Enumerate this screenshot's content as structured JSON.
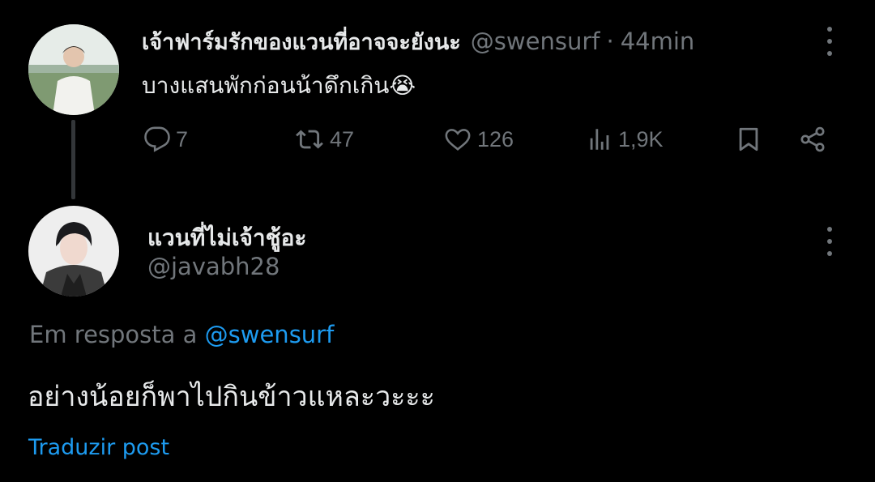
{
  "tweet1": {
    "display_name": "เจ้าฟาร์มรักของแวนที่อาจจะยังนะ",
    "handle": "@swensurf",
    "separator": "·",
    "time": "44min",
    "text": "บางแสนพักก่อนน้าดึกเกิน😭",
    "stats": {
      "replies": "7",
      "reposts": "47",
      "likes": "126",
      "views": "1,9K"
    },
    "icons": [
      "reply-icon",
      "repost-icon",
      "like-icon",
      "views-icon",
      "bookmark-icon",
      "share-icon",
      "more-icon"
    ]
  },
  "tweet2": {
    "display_name": "แวนที่ไม่เจ้าชู้อะ",
    "handle": "@javabh28",
    "reply_prefix": "Em resposta a",
    "reply_mention": "@swensurf",
    "text": "อย่างน้อยก็พาไปกินข้าวแหละวะะะ",
    "translate_label": "Traduzir post"
  },
  "colors": {
    "background": "#000000",
    "primary_text": "#e7e9ea",
    "secondary_text": "#71767b",
    "link": "#1d9bf0",
    "thread_line": "#333639"
  }
}
